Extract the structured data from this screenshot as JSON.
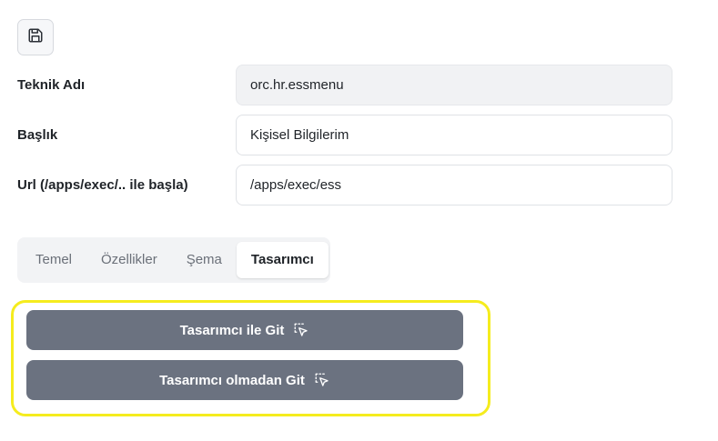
{
  "toolbar": {
    "save_icon": "floppy-disk-icon"
  },
  "form": {
    "technical_name": {
      "label": "Teknik Adı",
      "value": "orc.hr.essmenu"
    },
    "title": {
      "label": "Başlık",
      "value": "Kişisel Bilgilerim"
    },
    "url": {
      "label": "Url (/apps/exec/.. ile başla)",
      "value": "/apps/exec/ess"
    }
  },
  "tabs": [
    {
      "label": "Temel",
      "active": false
    },
    {
      "label": "Özellikler",
      "active": false
    },
    {
      "label": "Şema",
      "active": false
    },
    {
      "label": "Tasarımcı",
      "active": true
    }
  ],
  "actions": {
    "go_with_designer": {
      "label": "Tasarımcı ile Git",
      "icon": "cursor-click-icon"
    },
    "go_without_designer": {
      "label": "Tasarımcı olmadan Git",
      "icon": "cursor-click-icon"
    }
  },
  "colors": {
    "button_bg": "#6b7280",
    "highlight": "#f5ec1e",
    "readonly_bg": "#f1f2f4"
  }
}
